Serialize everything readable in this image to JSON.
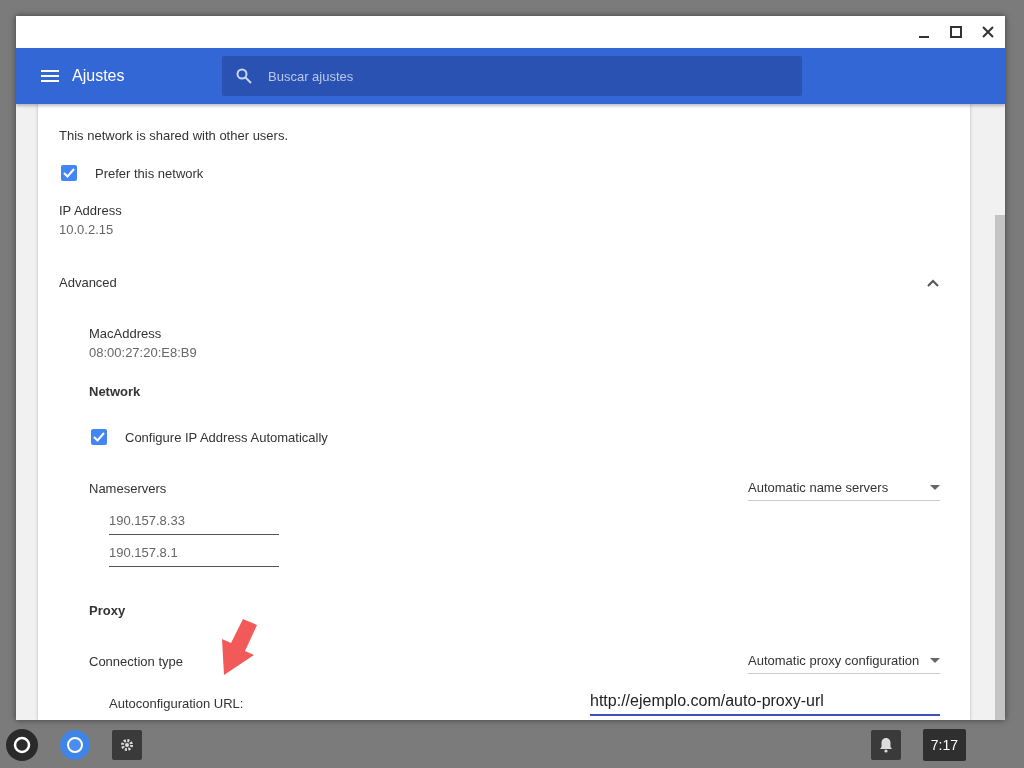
{
  "header": {
    "title": "Ajustes",
    "search": {
      "placeholder": "Buscar ajustes"
    }
  },
  "rows": [
    {
      "kind": "text",
      "text": "This network is shared with other users."
    },
    {
      "kind": "checkbox",
      "label": "Prefer this network",
      "checked": true
    },
    {
      "kind": "info",
      "label": "IP Address",
      "value": "10.0.2.15"
    }
  ],
  "advanced": {
    "label": "Advanced",
    "expanded": true,
    "rows": [
      {
        "kind": "info",
        "label": "MacAddress",
        "value": "08:00:27:20:E8:B9"
      },
      {
        "kind": "heading",
        "text": "Network"
      },
      {
        "kind": "checkbox",
        "label": "Configure IP Address Automatically",
        "checked": true
      },
      {
        "kind": "select",
        "label": "Nameservers",
        "value": "Automatic name servers"
      },
      {
        "kind": "field",
        "value": "190.157.8.33"
      },
      {
        "kind": "field",
        "value": "190.157.8.1"
      },
      {
        "kind": "heading",
        "text": "Proxy"
      },
      {
        "kind": "select",
        "label": "Connection type",
        "value": "Automatic proxy configuration"
      },
      {
        "kind": "url",
        "label": "Autoconfiguration URL:",
        "value": "http://ejemplo.com/auto-proxy-url"
      }
    ]
  },
  "shelf": {
    "time": "7:17"
  }
}
